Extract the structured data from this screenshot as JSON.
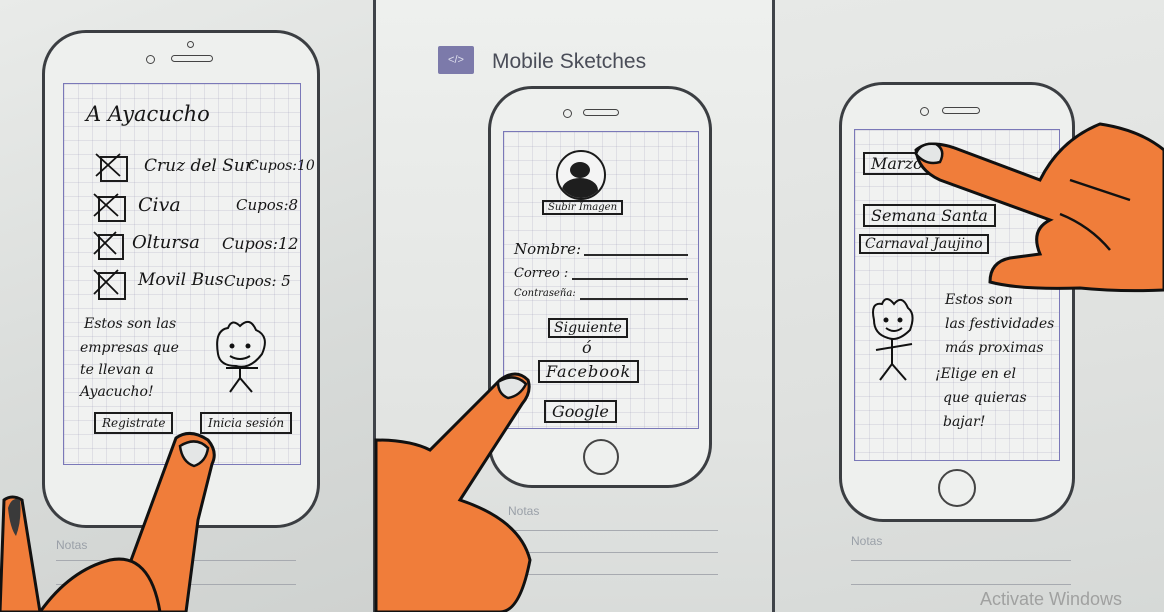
{
  "panel1": {
    "title": "A Ayacucho",
    "companies": [
      {
        "name": "Cruz del Sur",
        "seats": "Cupos:10"
      },
      {
        "name": "Civa",
        "seats": "Cupos:8"
      },
      {
        "name": "Oltursa",
        "seats": "Cupos:12"
      },
      {
        "name": "Movil Bus",
        "seats": "Cupos: 5"
      }
    ],
    "message_lines": [
      "Estos son las",
      "empresas que",
      "te llevan a",
      "Ayacucho!"
    ],
    "register_label": "Registrate",
    "login_label": "Inicia sesión",
    "notes_label": "Notas"
  },
  "panel2": {
    "header_icon": "</>",
    "header_title": "Mobile Sketches",
    "upload_label": "Subir Imagen",
    "name_label": "Nombre:",
    "email_label": "Correo :",
    "password_label": "Contraseña:",
    "next_label": "Siguiente",
    "or_label": "ó",
    "facebook_label": "Facebook",
    "google_label": "Google",
    "notes_label": "Notas"
  },
  "panel3": {
    "events": [
      "Marzo",
      "Semana Santa",
      "Carnaval Jaujino"
    ],
    "message_lines": [
      "Estos son",
      "las festividades",
      "más proximas",
      "¡Elige en el",
      "que quieras",
      "bajar!"
    ],
    "notes_label": "Notas"
  },
  "watermark": "Activate Windows",
  "colors": {
    "finger": "#f07d3a",
    "outline": "#111111",
    "screen_border": "#7a78b8"
  }
}
